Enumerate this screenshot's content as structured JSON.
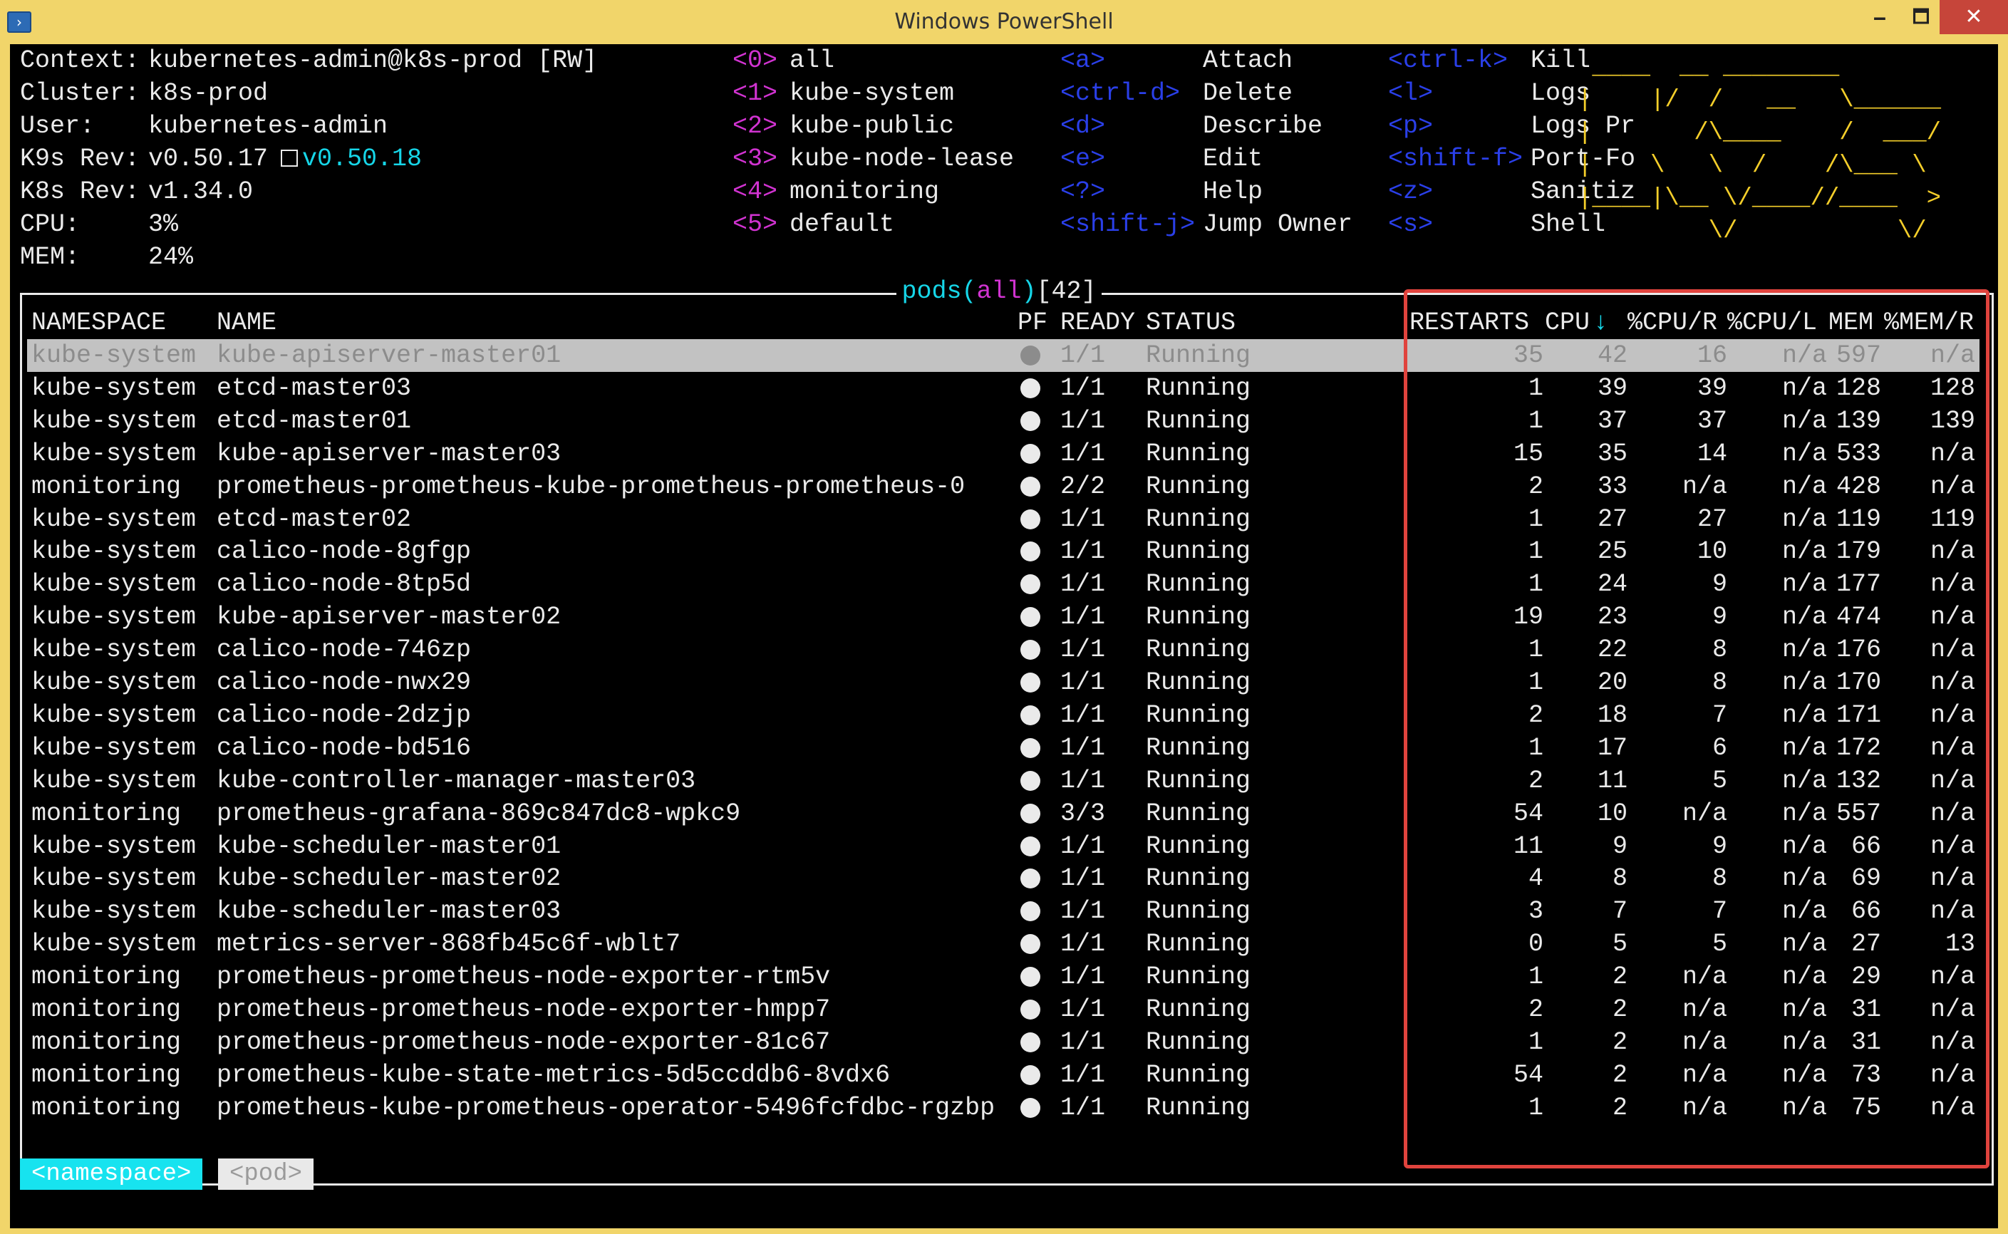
{
  "window": {
    "title": "Windows PowerShell",
    "minimize": "🗕",
    "maximize": "🗖",
    "close": "✕"
  },
  "info": [
    {
      "label": "Context:",
      "value": "kubernetes-admin@k8s-prod [RW]"
    },
    {
      "label": "Cluster:",
      "value": "k8s-prod"
    },
    {
      "label": "User:",
      "value": "kubernetes-admin"
    },
    {
      "label": "K9s Rev:",
      "value": "v0.50.17",
      "update": "v0.50.18"
    },
    {
      "label": "K8s Rev:",
      "value": "v1.34.0"
    },
    {
      "label": "CPU:",
      "value": "3%"
    },
    {
      "label": "MEM:",
      "value": "24%"
    }
  ],
  "namespaces": [
    {
      "key": "<0>",
      "name": "all"
    },
    {
      "key": "<1>",
      "name": "kube-system"
    },
    {
      "key": "<2>",
      "name": "kube-public"
    },
    {
      "key": "<3>",
      "name": "kube-node-lease"
    },
    {
      "key": "<4>",
      "name": "monitoring"
    },
    {
      "key": "<5>",
      "name": "default"
    }
  ],
  "shortcuts_a": [
    {
      "key": "<a>",
      "name": "Attach"
    },
    {
      "key": "<ctrl-d>",
      "name": "Delete"
    },
    {
      "key": "<d>",
      "name": "Describe"
    },
    {
      "key": "<e>",
      "name": "Edit"
    },
    {
      "key": "<?>",
      "name": "Help"
    },
    {
      "key": "<shift-j>",
      "name": "Jump Owner"
    }
  ],
  "shortcuts_b": [
    {
      "key": "<ctrl-k>",
      "name": "Kill"
    },
    {
      "key": "<l>",
      "name": "Logs"
    },
    {
      "key": "<p>",
      "name": "Logs Pr"
    },
    {
      "key": "<shift-f>",
      "name": "Port-Fo"
    },
    {
      "key": "<z>",
      "name": "Sanitiz"
    },
    {
      "key": "<s>",
      "name": "Shell"
    }
  ],
  "logo": {
    "text": "K9s",
    "lines": [
      " ____  __ ________",
      "|    |/  /   __   \\______",
      "|       /\\____    /  ___/",
      "|    \\   \\  /    /\\___ \\",
      "|____|\\__ \\/____//____  >",
      "         \\/           \\/"
    ]
  },
  "table": {
    "resource": "pods",
    "scope": "all",
    "count": "42",
    "columns": {
      "namespace": "NAMESPACE",
      "name": "NAME",
      "pf": "PF",
      "ready": "READY",
      "status": "STATUS",
      "restarts": "RESTARTS",
      "cpu": "CPU",
      "sort": "↓",
      "cpu_r": "%CPU/R",
      "cpu_l": "%CPU/L",
      "mem": "MEM",
      "mem_r": "%MEM/R"
    },
    "rows": [
      [
        "kube-system",
        "kube-apiserver-master01",
        "1/1",
        "Running",
        "35",
        "42",
        "16",
        "n/a",
        "597",
        "n/a"
      ],
      [
        "kube-system",
        "etcd-master03",
        "1/1",
        "Running",
        "1",
        "39",
        "39",
        "n/a",
        "128",
        "128"
      ],
      [
        "kube-system",
        "etcd-master01",
        "1/1",
        "Running",
        "1",
        "37",
        "37",
        "n/a",
        "139",
        "139"
      ],
      [
        "kube-system",
        "kube-apiserver-master03",
        "1/1",
        "Running",
        "15",
        "35",
        "14",
        "n/a",
        "533",
        "n/a"
      ],
      [
        "monitoring",
        "prometheus-prometheus-kube-prometheus-prometheus-0",
        "2/2",
        "Running",
        "2",
        "33",
        "n/a",
        "n/a",
        "428",
        "n/a"
      ],
      [
        "kube-system",
        "etcd-master02",
        "1/1",
        "Running",
        "1",
        "27",
        "27",
        "n/a",
        "119",
        "119"
      ],
      [
        "kube-system",
        "calico-node-8gfgp",
        "1/1",
        "Running",
        "1",
        "25",
        "10",
        "n/a",
        "179",
        "n/a"
      ],
      [
        "kube-system",
        "calico-node-8tp5d",
        "1/1",
        "Running",
        "1",
        "24",
        "9",
        "n/a",
        "177",
        "n/a"
      ],
      [
        "kube-system",
        "kube-apiserver-master02",
        "1/1",
        "Running",
        "19",
        "23",
        "9",
        "n/a",
        "474",
        "n/a"
      ],
      [
        "kube-system",
        "calico-node-746zp",
        "1/1",
        "Running",
        "1",
        "22",
        "8",
        "n/a",
        "176",
        "n/a"
      ],
      [
        "kube-system",
        "calico-node-nwx29",
        "1/1",
        "Running",
        "1",
        "20",
        "8",
        "n/a",
        "170",
        "n/a"
      ],
      [
        "kube-system",
        "calico-node-2dzjp",
        "1/1",
        "Running",
        "2",
        "18",
        "7",
        "n/a",
        "171",
        "n/a"
      ],
      [
        "kube-system",
        "calico-node-bd516",
        "1/1",
        "Running",
        "1",
        "17",
        "6",
        "n/a",
        "172",
        "n/a"
      ],
      [
        "kube-system",
        "kube-controller-manager-master03",
        "1/1",
        "Running",
        "2",
        "11",
        "5",
        "n/a",
        "132",
        "n/a"
      ],
      [
        "monitoring",
        "prometheus-grafana-869c847dc8-wpkc9",
        "3/3",
        "Running",
        "54",
        "10",
        "n/a",
        "n/a",
        "557",
        "n/a"
      ],
      [
        "kube-system",
        "kube-scheduler-master01",
        "1/1",
        "Running",
        "11",
        "9",
        "9",
        "n/a",
        "66",
        "n/a"
      ],
      [
        "kube-system",
        "kube-scheduler-master02",
        "1/1",
        "Running",
        "4",
        "8",
        "8",
        "n/a",
        "69",
        "n/a"
      ],
      [
        "kube-system",
        "kube-scheduler-master03",
        "1/1",
        "Running",
        "3",
        "7",
        "7",
        "n/a",
        "66",
        "n/a"
      ],
      [
        "kube-system",
        "metrics-server-868fb45c6f-wblt7",
        "1/1",
        "Running",
        "0",
        "5",
        "5",
        "n/a",
        "27",
        "13"
      ],
      [
        "monitoring",
        "prometheus-prometheus-node-exporter-rtm5v",
        "1/1",
        "Running",
        "1",
        "2",
        "n/a",
        "n/a",
        "29",
        "n/a"
      ],
      [
        "monitoring",
        "prometheus-prometheus-node-exporter-hmpp7",
        "1/1",
        "Running",
        "2",
        "2",
        "n/a",
        "n/a",
        "31",
        "n/a"
      ],
      [
        "monitoring",
        "prometheus-prometheus-node-exporter-81c67",
        "1/1",
        "Running",
        "1",
        "2",
        "n/a",
        "n/a",
        "31",
        "n/a"
      ],
      [
        "monitoring",
        "prometheus-kube-state-metrics-5d5ccddb6-8vdx6",
        "1/1",
        "Running",
        "54",
        "2",
        "n/a",
        "n/a",
        "73",
        "n/a"
      ],
      [
        "monitoring",
        "prometheus-kube-prometheus-operator-5496fcfdbc-rgzbp",
        "1/1",
        "Running",
        "1",
        "2",
        "n/a",
        "n/a",
        "75",
        "n/a"
      ]
    ]
  },
  "crumbs": {
    "namespace": "<namespace>",
    "pod": "<pod>"
  },
  "colors": {
    "title_bar": "#F1D56A",
    "highlight_box": "#E0433D",
    "selected_row": "#C2C2C2",
    "accent_cyan": "#16D6E8",
    "accent_magenta": "#D133D1",
    "logo_yellow": "#F4CE2A"
  }
}
